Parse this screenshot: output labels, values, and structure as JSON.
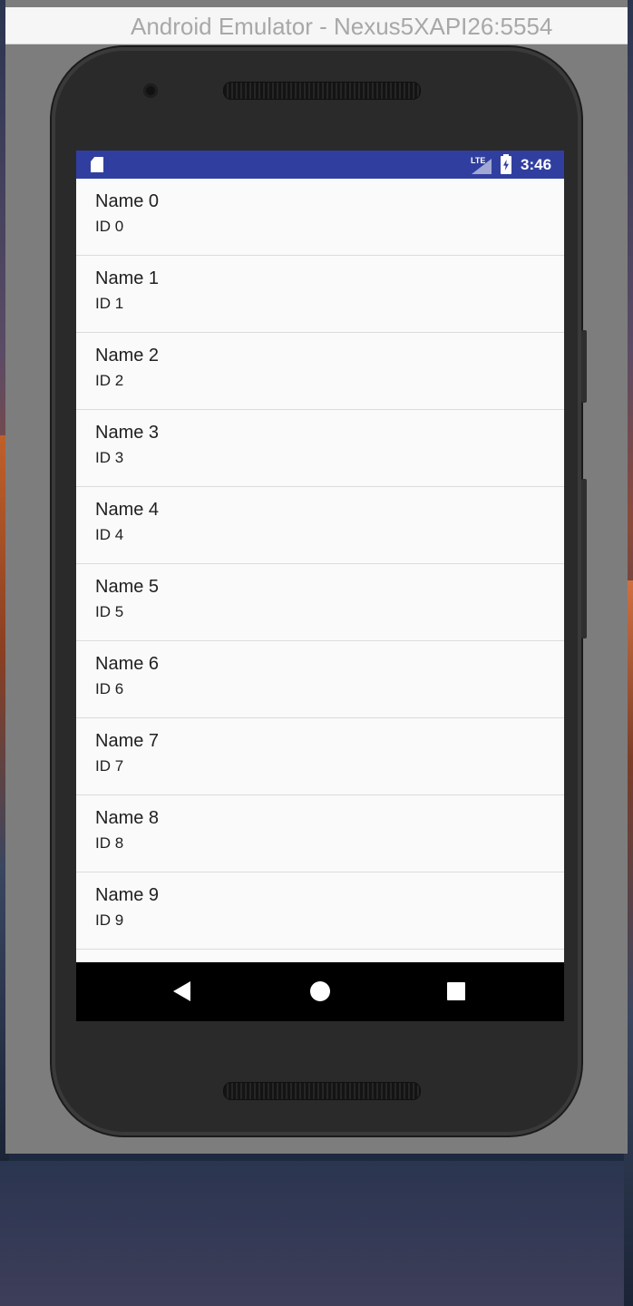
{
  "window": {
    "title": "Android Emulator - Nexus5XAPI26:5554"
  },
  "status_bar": {
    "network": "LTE",
    "time": "3:46",
    "background_color": "#303f9f",
    "icons": [
      "sd-card-icon",
      "signal-icon",
      "battery-charging-icon"
    ]
  },
  "list": {
    "items": [
      {
        "name": "Name 0",
        "id": "ID 0"
      },
      {
        "name": "Name 1",
        "id": "ID 1"
      },
      {
        "name": "Name 2",
        "id": "ID 2"
      },
      {
        "name": "Name 3",
        "id": "ID 3"
      },
      {
        "name": "Name 4",
        "id": "ID 4"
      },
      {
        "name": "Name 5",
        "id": "ID 5"
      },
      {
        "name": "Name 6",
        "id": "ID 6"
      },
      {
        "name": "Name 7",
        "id": "ID 7"
      },
      {
        "name": "Name 8",
        "id": "ID 8"
      },
      {
        "name": "Name 9",
        "id": "ID 9"
      },
      {
        "name": "",
        "id": ""
      }
    ]
  },
  "nav_bar": {
    "icons": [
      "back-icon",
      "home-icon",
      "recents-icon"
    ]
  }
}
